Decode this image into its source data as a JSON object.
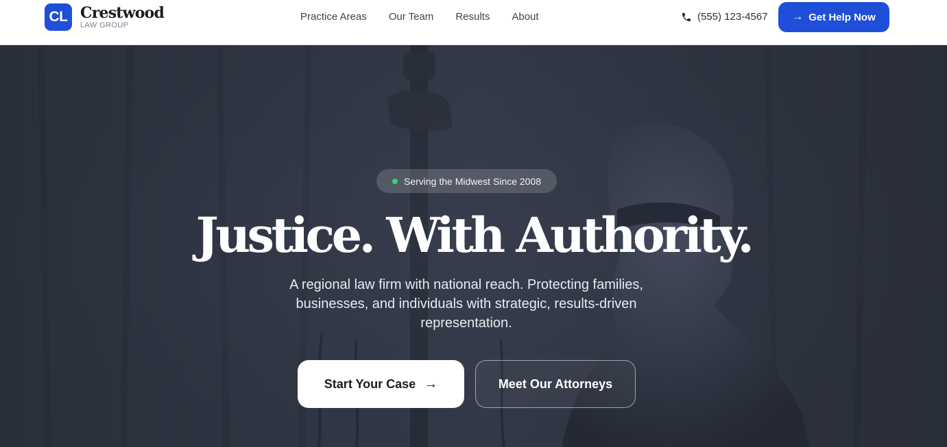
{
  "header": {
    "logo_mark": "CL",
    "logo_name": "Crestwood",
    "logo_sub": "LAW GROUP",
    "nav": [
      "Practice Areas",
      "Our Team",
      "Results",
      "About"
    ],
    "phone": "(555) 123-4567",
    "cta_label": "Get Help Now"
  },
  "hero": {
    "badge": "Serving the Midwest Since 2008",
    "headline": "Justice. With Authority.",
    "subtext": "A regional law firm with national reach. Protecting families, businesses, and individuals with strategic, results-driven representation.",
    "primary_button": "Start Your Case",
    "secondary_button": "Meet Our Attorneys"
  },
  "colors": {
    "brand": "#1f4fd8",
    "hero_bg": "#313746",
    "badge_dot": "#34d27a"
  },
  "icons": {
    "phone": "phone-icon",
    "arrow": "arrow-right-icon"
  }
}
